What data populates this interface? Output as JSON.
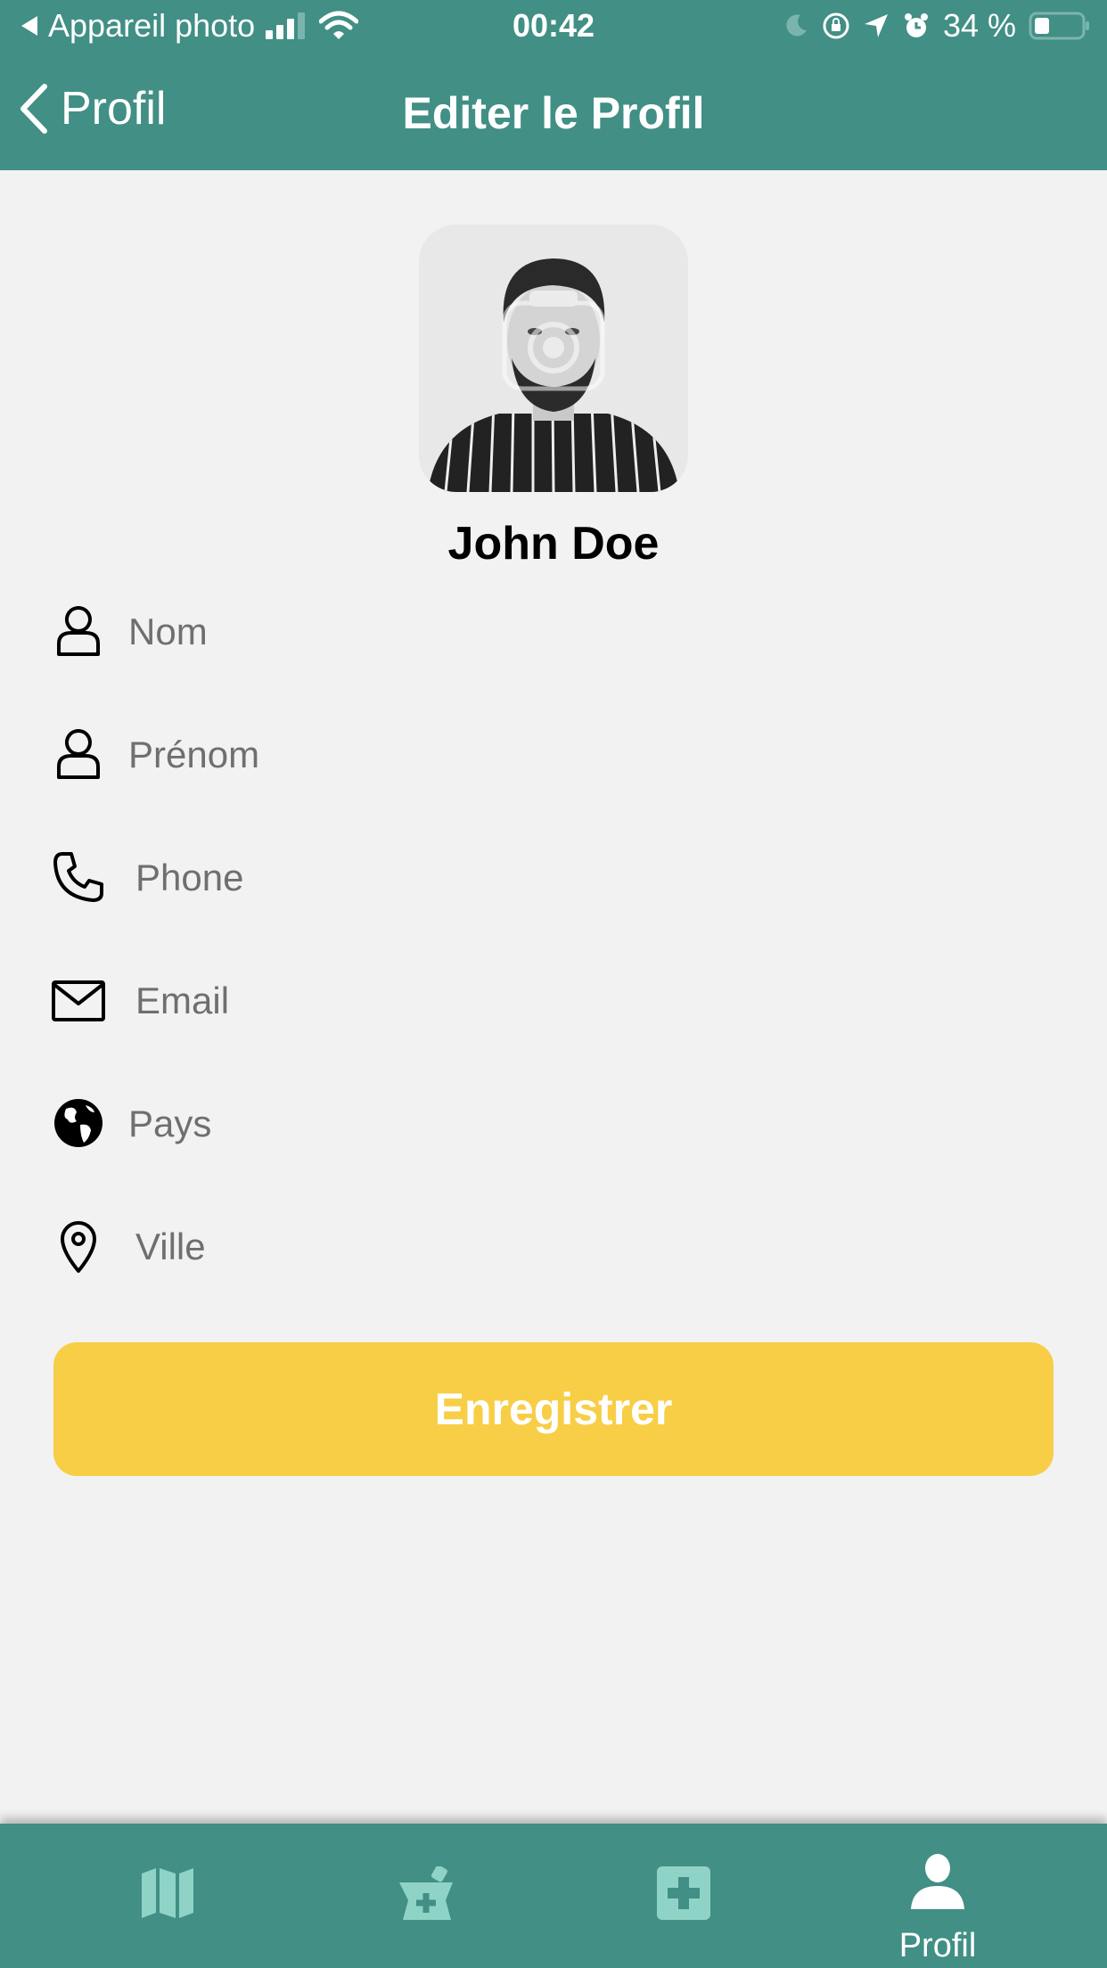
{
  "status_bar": {
    "back_app": "Appareil photo",
    "time": "00:42",
    "battery": "34 %"
  },
  "nav": {
    "back_label": "Profil",
    "title": "Editer le Profil"
  },
  "profile": {
    "name": "John Doe"
  },
  "form": {
    "nom_placeholder": "Nom",
    "prenom_placeholder": "Prénom",
    "phone_placeholder": "Phone",
    "email_placeholder": "Email",
    "pays_placeholder": "Pays",
    "ville_placeholder": "Ville"
  },
  "actions": {
    "save_label": "Enregistrer"
  },
  "tabbar": {
    "items": [
      {
        "icon": "map-icon",
        "label": ""
      },
      {
        "icon": "pharmacy-icon",
        "label": ""
      },
      {
        "icon": "medical-cross-icon",
        "label": ""
      },
      {
        "icon": "person-icon",
        "label": "Profil"
      }
    ]
  },
  "colors": {
    "header": "#418f85",
    "accent_button": "#f7ce46",
    "background": "#f2f2f2",
    "tab_inactive": "#8fd3c7"
  }
}
